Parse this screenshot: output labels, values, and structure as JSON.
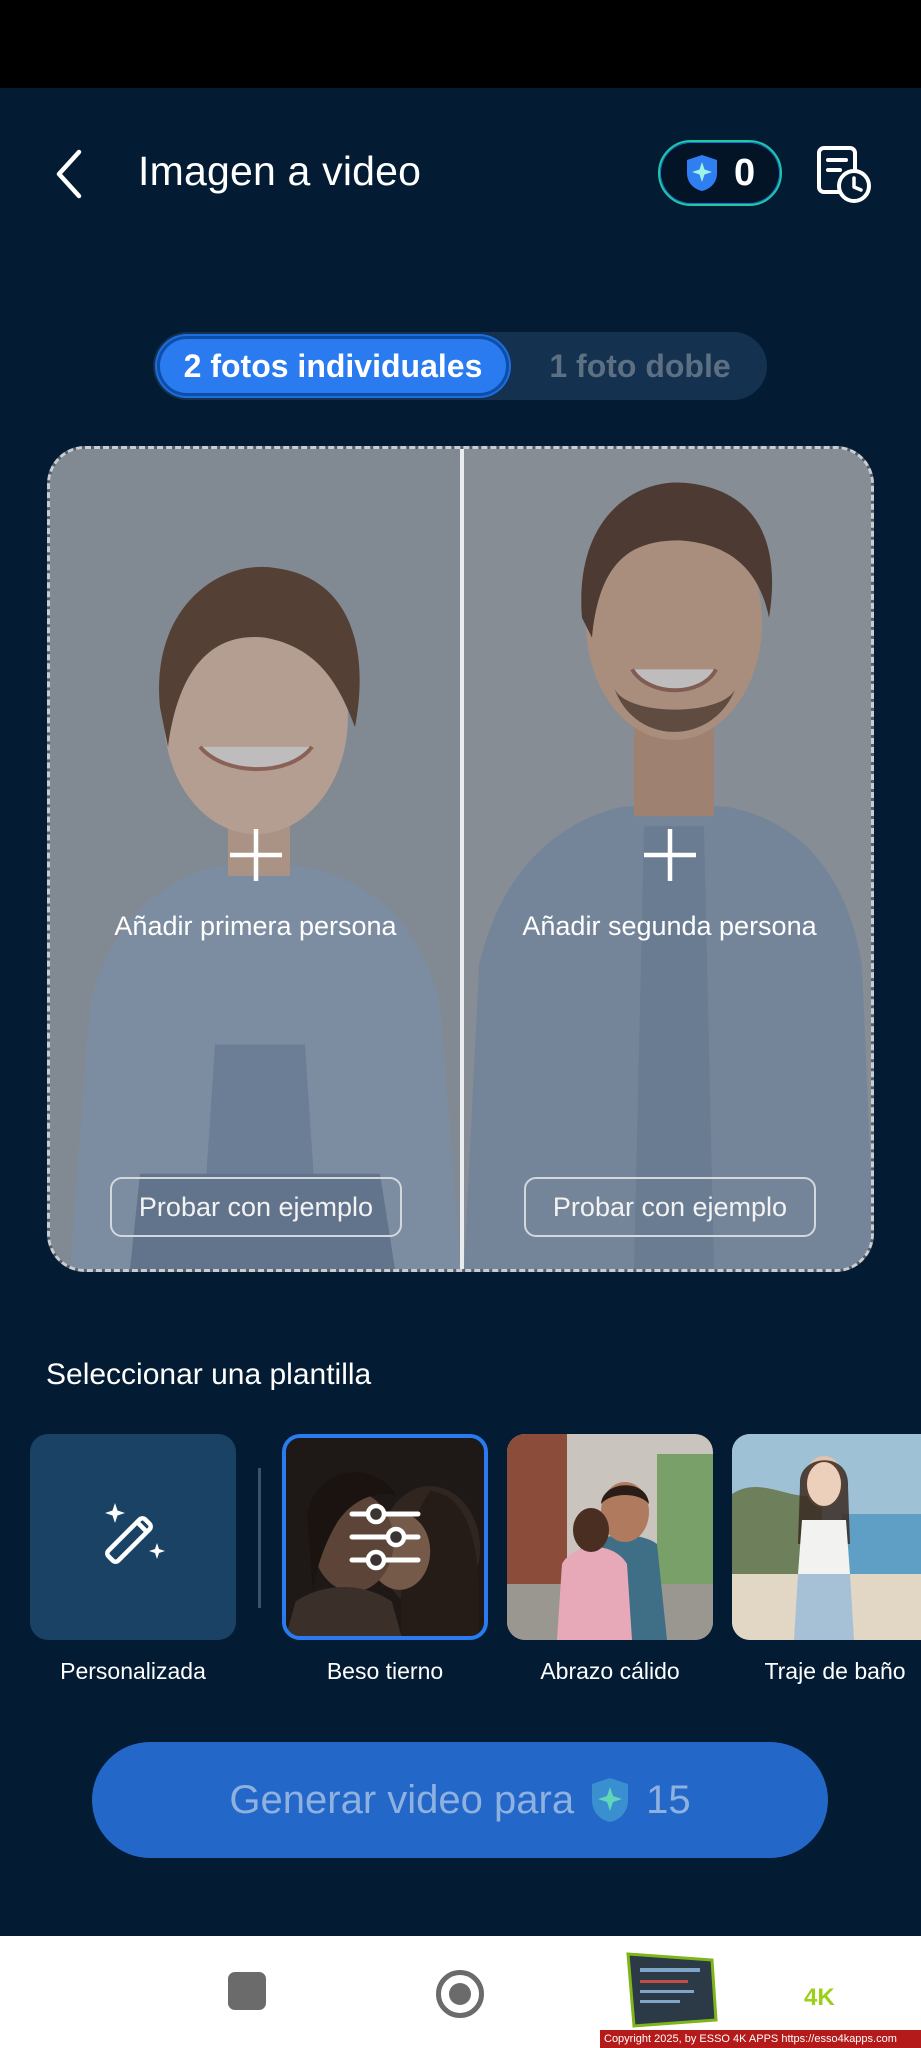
{
  "header": {
    "title": "Imagen a video",
    "credits": "0"
  },
  "mode_tabs": {
    "active": "2 fotos individuales",
    "inactive": "1 foto doble"
  },
  "upload": {
    "first": {
      "label": "Añadir primera persona",
      "example": "Probar con ejemplo"
    },
    "second": {
      "label": "Añadir segunda persona",
      "example": "Probar con ejemplo"
    }
  },
  "templates": {
    "title": "Seleccionar una plantilla",
    "items": [
      {
        "name": "Personalizada",
        "icon": "magic-wand-icon"
      },
      {
        "name": "Beso tierno",
        "selected": true,
        "icon": "sliders-icon"
      },
      {
        "name": "Abrazo cálido"
      },
      {
        "name": "Traje de baño"
      }
    ]
  },
  "generate": {
    "label": "Generar video para",
    "cost": "15"
  },
  "watermark": {
    "brand": "4K",
    "copyright": "Copyright 2025, by ESSO 4K APPS https://esso4kapps.com"
  },
  "colors": {
    "background": "#031b33",
    "accent": "#2a7bf0",
    "credit_border": "#1ec9a6"
  }
}
